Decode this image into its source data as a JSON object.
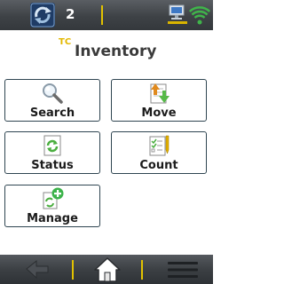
{
  "status_bar": {
    "pending_count": "2",
    "app_icon": "sync-refresh-icon",
    "network_icon": "computer-network-icon",
    "signal_icon": "wifi-signal-icon"
  },
  "header": {
    "badge": "TC",
    "title": "Inventory"
  },
  "tiles": [
    {
      "label": "Search",
      "icon": "magnifier-icon"
    },
    {
      "label": "Move",
      "icon": "move-arrows-icon"
    },
    {
      "label": "Status",
      "icon": "status-recycle-icon"
    },
    {
      "label": "Count",
      "icon": "checklist-pencil-icon"
    },
    {
      "label": "Manage",
      "icon": "manage-add-icon"
    }
  ],
  "bottom_bar": {
    "back_icon": "back-arrow-icon",
    "home_icon": "home-icon",
    "menu_icon": "hamburger-menu-icon"
  },
  "colors": {
    "accent": "#e2c200",
    "tile_border": "#2f4551",
    "bar_dark": "#3e4246"
  }
}
